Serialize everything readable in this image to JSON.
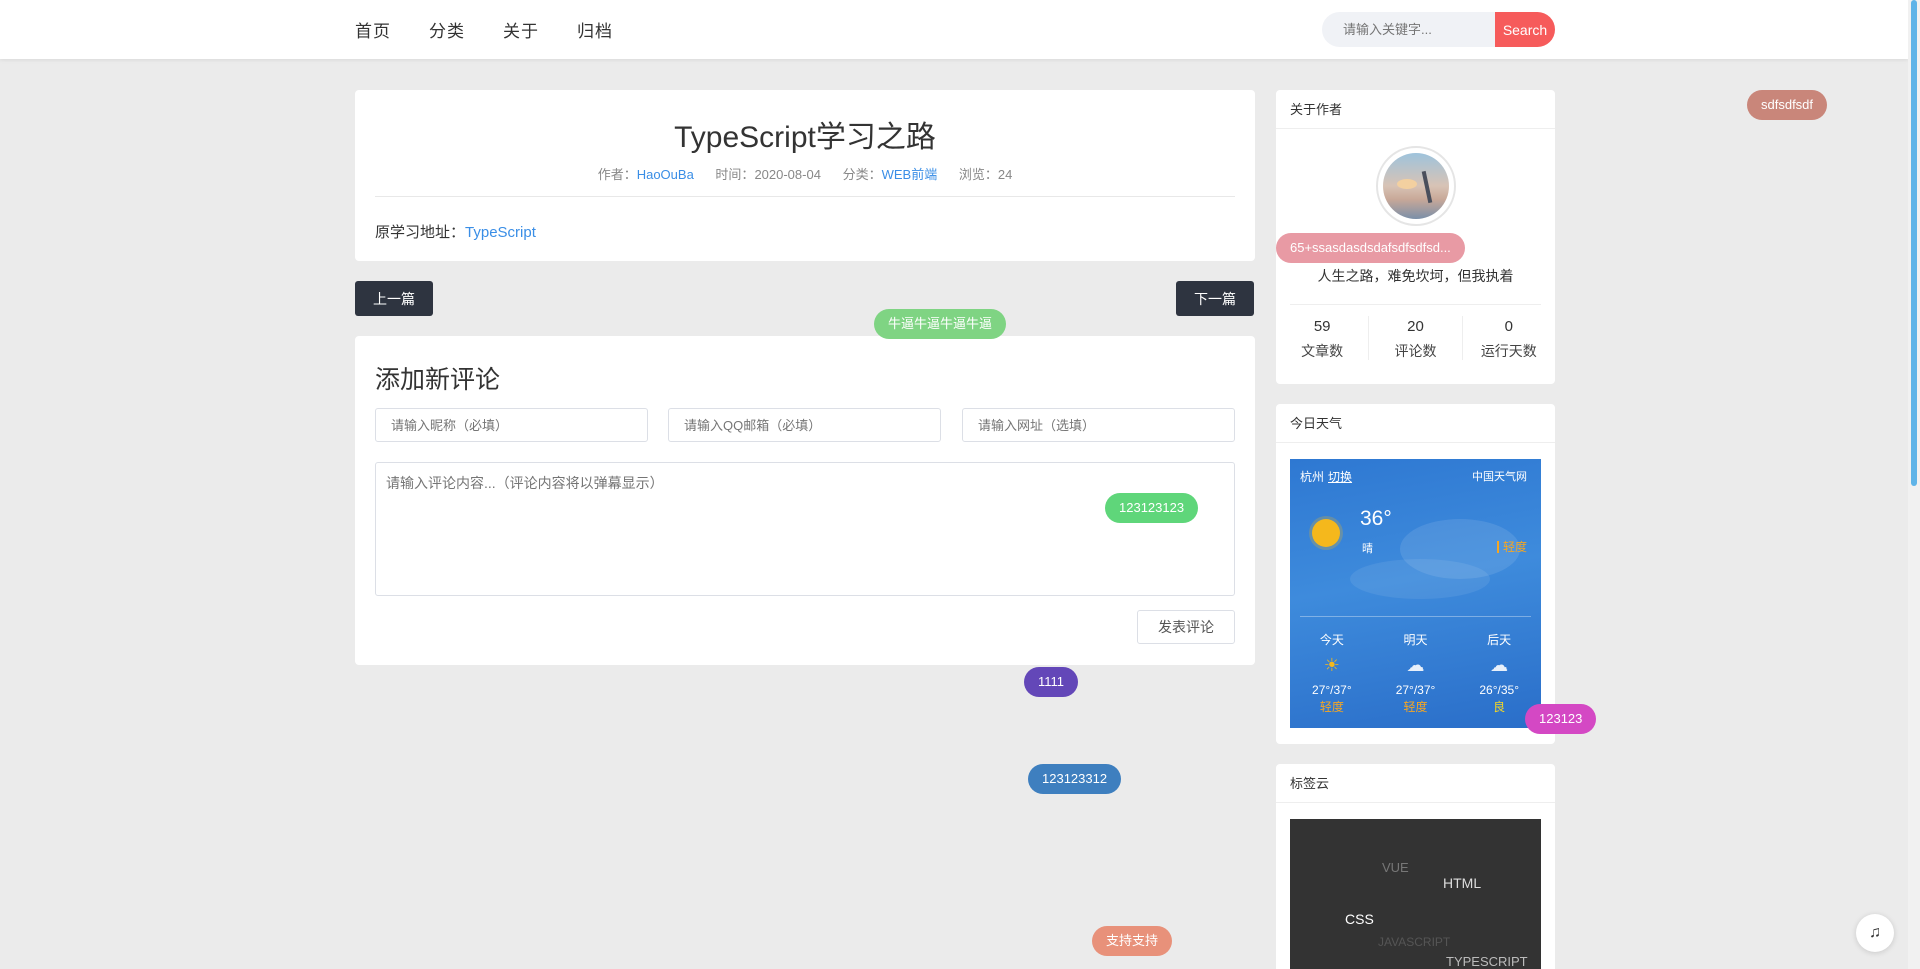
{
  "nav": {
    "items": [
      "首页",
      "分类",
      "关于",
      "归档"
    ],
    "search_placeholder": "请输入关键字...",
    "search_button": "Search"
  },
  "article": {
    "title": "TypeScript学习之路",
    "author_label": "作者：",
    "author": "HaoOuBa",
    "time_label": "时间：",
    "date": "2020-08-04",
    "category_label": "分类：",
    "category": "WEB前端",
    "views_label": "浏览：",
    "views": "24",
    "source_label": "原学习地址：",
    "source_link": "TypeScript"
  },
  "pager": {
    "prev": "上一篇",
    "next": "下一篇"
  },
  "comment": {
    "title": "添加新评论",
    "nickname_placeholder": "请输入昵称（必填）",
    "email_placeholder": "请输入QQ邮箱（必填）",
    "url_placeholder": "请输入网址（选填）",
    "content_placeholder": "请输入评论内容...（评论内容将以弹幕显示）",
    "submit": "发表评论"
  },
  "author_card": {
    "title": "关于作者",
    "motto": "人生之路，难免坎坷，但我执着",
    "stats": [
      {
        "value": "59",
        "label": "文章数"
      },
      {
        "value": "20",
        "label": "评论数"
      },
      {
        "value": "0",
        "label": "运行天数"
      }
    ]
  },
  "weather": {
    "title": "今日天气",
    "city": "杭州",
    "switch": "切换",
    "source": "中国天气网",
    "temp": "36°",
    "condition": "晴",
    "aqi": "轻度",
    "days": [
      {
        "name": "今天",
        "icon": "sun-icon",
        "range": "27°/37°",
        "quality": "轻度"
      },
      {
        "name": "明天",
        "icon": "cloud-rain-icon",
        "range": "27°/37°",
        "quality": "轻度"
      },
      {
        "name": "后天",
        "icon": "cloud-rain-icon",
        "range": "26°/35°",
        "quality": "良"
      }
    ]
  },
  "tags_card": {
    "title": "标签云",
    "tags": [
      "VUE",
      "HTML",
      "CSS",
      "JAVASCRIPT",
      "TYPESCRIPT"
    ]
  },
  "danmaku": [
    {
      "text": "sdfsdfsdf",
      "color": "#c9867a"
    },
    {
      "text": "65+ssasdasdsdafsdfsdfsd...",
      "color": "#e89aa4"
    },
    {
      "text": "牛逼牛逼牛逼牛逼",
      "color": "#7fd483"
    },
    {
      "text": "123123123",
      "color": "#5fd67a"
    },
    {
      "text": "1111",
      "color": "#6347b8"
    },
    {
      "text": "123123",
      "color": "#d448c4"
    },
    {
      "text": "123123312",
      "color": "#3e7fbf"
    },
    {
      "text": "支持支持",
      "color": "#e8917a"
    }
  ]
}
